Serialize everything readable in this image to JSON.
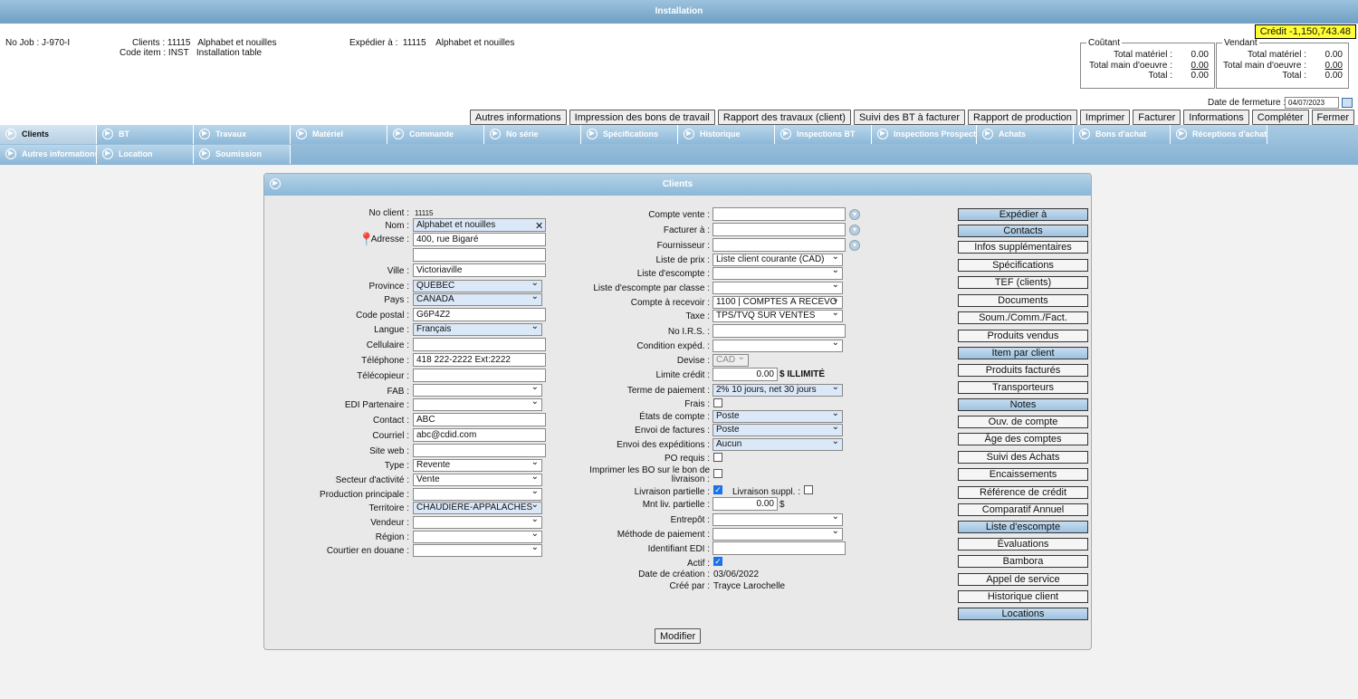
{
  "window_title": "Installation",
  "header": {
    "job": "No Job : J-970-I",
    "clients": "Clients : 11115   Alphabet et nouilles",
    "code_item": "Code item : INST   Installation table",
    "ship_to": "Expédier à :  11115    Alphabet et nouilles",
    "credit": "Crédit -1,150,743.48",
    "cost": {
      "legend": "Coûtant",
      "mat_label": "Total matériel :",
      "mat": "0.00",
      "mo_label": "Total main d'oeuvre :",
      "mo": "0.00",
      "tot_label": "Total :",
      "tot": "0.00"
    },
    "sell": {
      "legend": "Vendant",
      "mat_label": "Total matériel :",
      "mat": "0.00",
      "mo_label": "Total main d'oeuvre :",
      "mo": "0.00",
      "tot_label": "Total :",
      "tot": "0.00"
    },
    "close_date_label": "Date de fermeture :",
    "close_date": "04/07/2023"
  },
  "toolbar": [
    "Autres informations",
    "Impression des bons de travail",
    "Rapport des travaux (client)",
    "Suivi des BT à facturer",
    "Rapport de production",
    "Imprimer",
    "Facturer",
    "Informations",
    "Compléter",
    "Fermer"
  ],
  "tabs_row1": [
    "Clients",
    "BT",
    "Travaux",
    "Matériel",
    "Commande",
    "No série",
    "Spécifications",
    "Historique",
    "Inspections BT",
    "Inspections Prospect",
    "Achats",
    "Bons d'achat",
    "Réceptions d'achat"
  ],
  "tabs_row2": [
    "Autres informations",
    "Location",
    "Soumission"
  ],
  "panel_title": "Clients",
  "left": {
    "no_client_label": "No client :",
    "no_client": "11115",
    "nom_label": "Nom :",
    "nom": "Alphabet et nouilles",
    "adresse_label": "Adresse :",
    "adresse": "400, rue Bigaré",
    "adresse2": "",
    "ville_label": "Ville :",
    "ville": "Victoriaville",
    "province_label": "Province :",
    "province": "QUÉBEC",
    "pays_label": "Pays :",
    "pays": "CANADA",
    "cp_label": "Code postal :",
    "cp": "G6P4Z2",
    "langue_label": "Langue :",
    "langue": "Français",
    "cell_label": "Cellulaire :",
    "cell": "",
    "tel_label": "Téléphone :",
    "tel": "418 222-2222  Ext:2222",
    "fax_label": "Télécopieur :",
    "fax": "",
    "fab_label": "FAB :",
    "fab": "",
    "edi_label": "EDI Partenaire :",
    "edi": "",
    "contact_label": "Contact :",
    "contact": "ABC",
    "courriel_label": "Courriel :",
    "courriel": "abc@cdid.com",
    "web_label": "Site web :",
    "web": "",
    "type_label": "Type :",
    "type": "Revente",
    "secteur_label": "Secteur d'activité :",
    "secteur": "Vente",
    "prod_label": "Production principale :",
    "prod": "",
    "terr_label": "Territoire :",
    "terr": "CHAUDIÈRE-APPALACHES",
    "vendeur_label": "Vendeur :",
    "vendeur": "",
    "region_label": "Région :",
    "region": "",
    "courtier_label": "Courtier en douane :",
    "courtier": ""
  },
  "mid": {
    "cv_label": "Compte vente :",
    "fa_label": "Facturer à :",
    "four_label": "Fournisseur :",
    "lp_label": "Liste de prix :",
    "lp": "Liste client courante (CAD)",
    "le_label": "Liste d'escompte :",
    "lec_label": "Liste d'escompte par classe :",
    "car_label": "Compte à recevoir :",
    "car": "1100 | COMPTES À RECEVO",
    "taxe_label": "Taxe :",
    "taxe": "TPS/TVQ SUR VENTES",
    "irs_label": "No I.R.S. :",
    "ce_label": "Condition expéd. :",
    "devise_label": "Devise :",
    "devise": "CAD",
    "lc_label": "Limite crédit :",
    "lc": "0.00",
    "lc_suffix": "$ ILLIMITÉ",
    "tp_label": "Terme de paiement :",
    "tp": "2% 10 jours, net 30 jours",
    "frais_label": "Frais :",
    "etat_label": "États de compte :",
    "etat": "Poste",
    "envf_label": "Envoi de factures :",
    "envf": "Poste",
    "enve_label": "Envoi des expéditions :",
    "enve": "Aucun",
    "po_label": "PO requis :",
    "bo_label1": "Imprimer les BO sur le bon de",
    "bo_label2": "livraison :",
    "lp2_label": "Livraison partielle :",
    "ls_label": "Livraison suppl. :",
    "mnt_label": "Mnt liv. partielle :",
    "mnt": "0.00",
    "mnt_suffix": "$",
    "ent_label": "Entrepôt :",
    "mp_label": "Méthode de paiement :",
    "ide_label": "Identifiant EDI :",
    "actif_label": "Actif :",
    "dc_label": "Date de création :",
    "dc": "03/06/2022",
    "cp_label": "Créé par :",
    "cp": "Trayce Larochelle"
  },
  "right_buttons": [
    "Expédier à",
    "Contacts",
    "Infos supplémentaires",
    "Spécifications",
    "TEF (clients)",
    "Documents",
    "Soum./Comm./Fact.",
    "Produits vendus",
    "Item par client",
    "Produits facturés",
    "Transporteurs",
    "Notes",
    "Ouv. de compte",
    "Âge des comptes",
    "Suivi des Achats",
    "Encaissements",
    "Référence de crédit",
    "Comparatif Annuel",
    "Liste d'escompte",
    "Évaluations",
    "Bambora",
    "Appel de service",
    "Historique client",
    "Locations"
  ],
  "modify_label": "Modifier"
}
